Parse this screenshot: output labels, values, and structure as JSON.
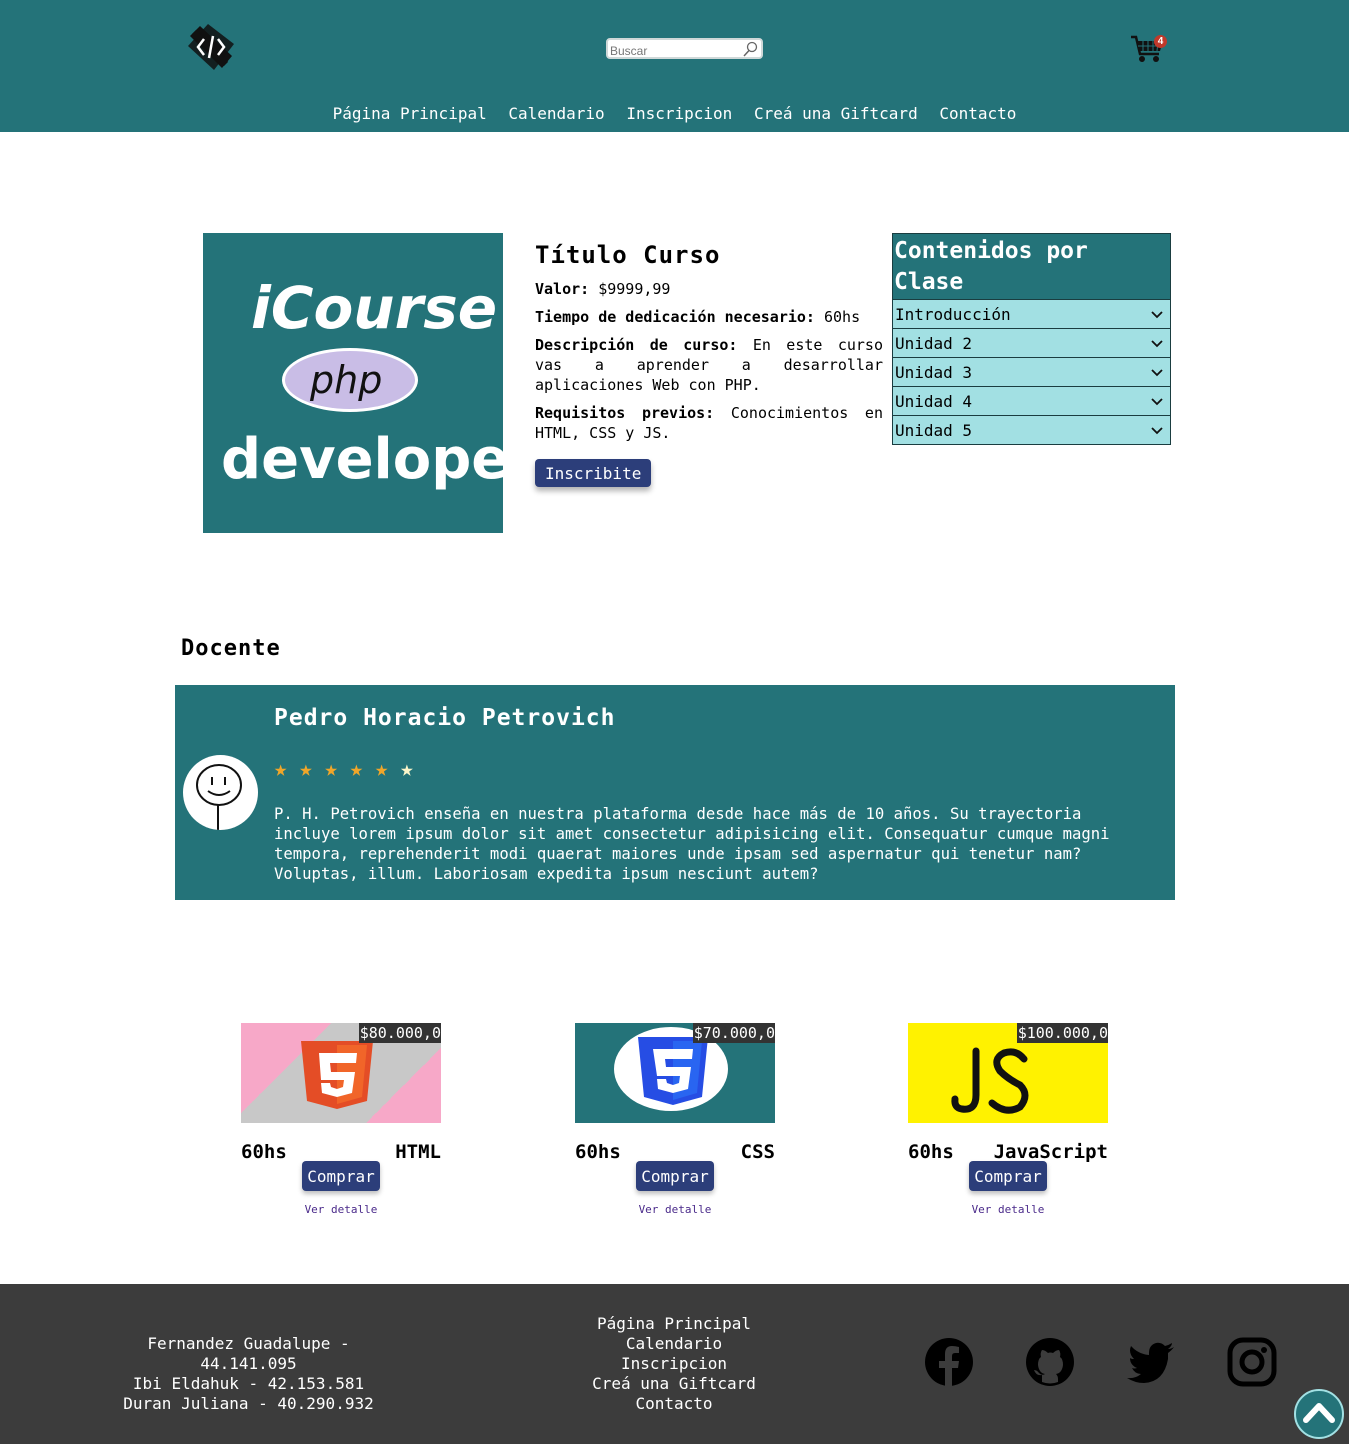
{
  "header": {
    "search_placeholder": "Buscar",
    "cart_count": "4",
    "nav": [
      "Página Principal",
      "Calendario",
      "Inscripcion",
      "Creá una Giftcard",
      "Contacto"
    ]
  },
  "course": {
    "image_text": [
      "iCourse",
      "php",
      "developer"
    ],
    "title": "Título Curso",
    "price_label": "Valor:",
    "price_value": " $9999,99",
    "time_label": "Tiempo de dedicación necesario:",
    "time_value": " 60hs",
    "desc_label": "Descripción de curso:",
    "desc_value": " En este curso vas a aprender a desarrollar aplicaciones Web con PHP.",
    "req_label": "Requisitos previos:",
    "req_value": " Conocimientos en HTML, CSS y JS.",
    "button": "Inscribite"
  },
  "contents": {
    "title": "Contenidos por Clase",
    "items": [
      "Introducción",
      "Unidad 2",
      "Unidad 3",
      "Unidad 4",
      "Unidad 5"
    ]
  },
  "teacher": {
    "section_title": "Docente",
    "name": "Pedro Horacio Petrovich",
    "rating": 5.5,
    "rating_max": 6,
    "bio": "P. H. Petrovich enseña en nuestra plataforma desde hace más de 10 años. Su trayectoria incluye lorem ipsum dolor sit amet consectetur adipisicing elit. Consequatur cumque magni tempora, reprehenderit modi quaerat maiores unde ipsam sed aspernatur qui tenetur nam? Voluptas, illum. Laboriosam expedita ipsum nesciunt autem?"
  },
  "products": [
    {
      "price": "$80.000,0",
      "hours": "60hs",
      "name": "HTML",
      "buy": "Comprar",
      "detail": "Ver detalle"
    },
    {
      "price": "$70.000,0",
      "hours": "60hs",
      "name": "CSS",
      "buy": "Comprar",
      "detail": "Ver detalle"
    },
    {
      "price": "$100.000,0",
      "hours": "60hs",
      "name": "JavaScript",
      "buy": "Comprar",
      "detail": "Ver detalle"
    }
  ],
  "footer": {
    "people": [
      "Fernandez Guadalupe - 44.141.095",
      "Ibi Eldahuk - 42.153.581",
      "Duran Juliana - 40.290.932"
    ],
    "nav": [
      "Página Principal",
      "Calendario",
      "Inscripcion",
      "Creá una Giftcard",
      "Contacto"
    ],
    "social": [
      "facebook-icon",
      "github-icon",
      "twitter-icon",
      "instagram-icon"
    ]
  },
  "colors": {
    "primary": "#247379",
    "accent_light": "#a2e0e3",
    "button": "#2c3e7a",
    "footer": "#3c3c3c",
    "star": "#f0a62a"
  }
}
